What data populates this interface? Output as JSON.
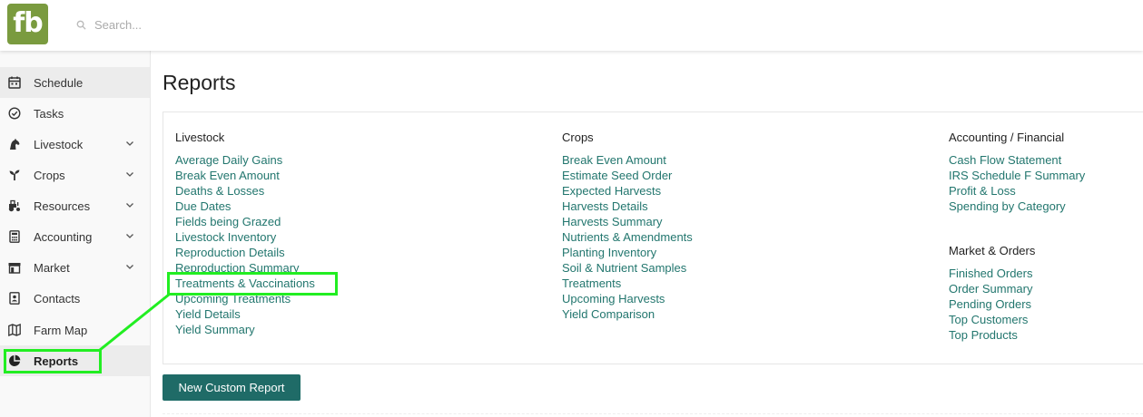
{
  "app": {
    "logo_text": "fb",
    "brand_color": "#7a9b3f",
    "search_placeholder": "Search..."
  },
  "sidebar": {
    "items": [
      {
        "label": "Schedule",
        "icon": "calendar-icon",
        "has_chevron": false
      },
      {
        "label": "Tasks",
        "icon": "check-circle-icon",
        "has_chevron": false
      },
      {
        "label": "Livestock",
        "icon": "horse-icon",
        "has_chevron": true
      },
      {
        "label": "Crops",
        "icon": "seedling-icon",
        "has_chevron": true
      },
      {
        "label": "Resources",
        "icon": "tractor-icon",
        "has_chevron": true
      },
      {
        "label": "Accounting",
        "icon": "calculator-icon",
        "has_chevron": true
      },
      {
        "label": "Market",
        "icon": "store-icon",
        "has_chevron": true
      },
      {
        "label": "Contacts",
        "icon": "contact-card-icon",
        "has_chevron": false
      },
      {
        "label": "Farm Map",
        "icon": "map-icon",
        "has_chevron": false
      },
      {
        "label": "Reports",
        "icon": "pie-chart-icon",
        "has_chevron": false
      }
    ]
  },
  "main": {
    "title": "Reports",
    "columns": [
      {
        "heading": "Livestock",
        "links": [
          "Average Daily Gains",
          "Break Even Amount",
          "Deaths & Losses",
          "Due Dates",
          "Fields being Grazed",
          "Livestock Inventory",
          "Reproduction Details",
          "Reproduction Summary",
          "Treatments & Vaccinations",
          "Upcoming Treatments",
          "Yield Details",
          "Yield Summary"
        ]
      },
      {
        "heading": "Crops",
        "links": [
          "Break Even Amount",
          "Estimate Seed Order",
          "Expected Harvests",
          "Harvests Details",
          "Harvests Summary",
          "Nutrients & Amendments",
          "Planting Inventory",
          "Soil & Nutrient Samples",
          "Treatments",
          "Upcoming Harvests",
          "Yield Comparison"
        ]
      },
      {
        "heading": "Accounting / Financial",
        "links": [
          "Cash Flow Statement",
          "IRS Schedule F Summary",
          "Profit & Loss",
          "Spending by Category"
        ]
      },
      {
        "heading": "Market & Orders",
        "links": [
          "Finished Orders",
          "Order Summary",
          "Pending Orders",
          "Top Customers",
          "Top Products"
        ]
      }
    ],
    "new_report_button": "New Custom Report"
  },
  "colors": {
    "link": "#22766e",
    "button": "#1f6b67",
    "highlight": "#22ee22"
  }
}
